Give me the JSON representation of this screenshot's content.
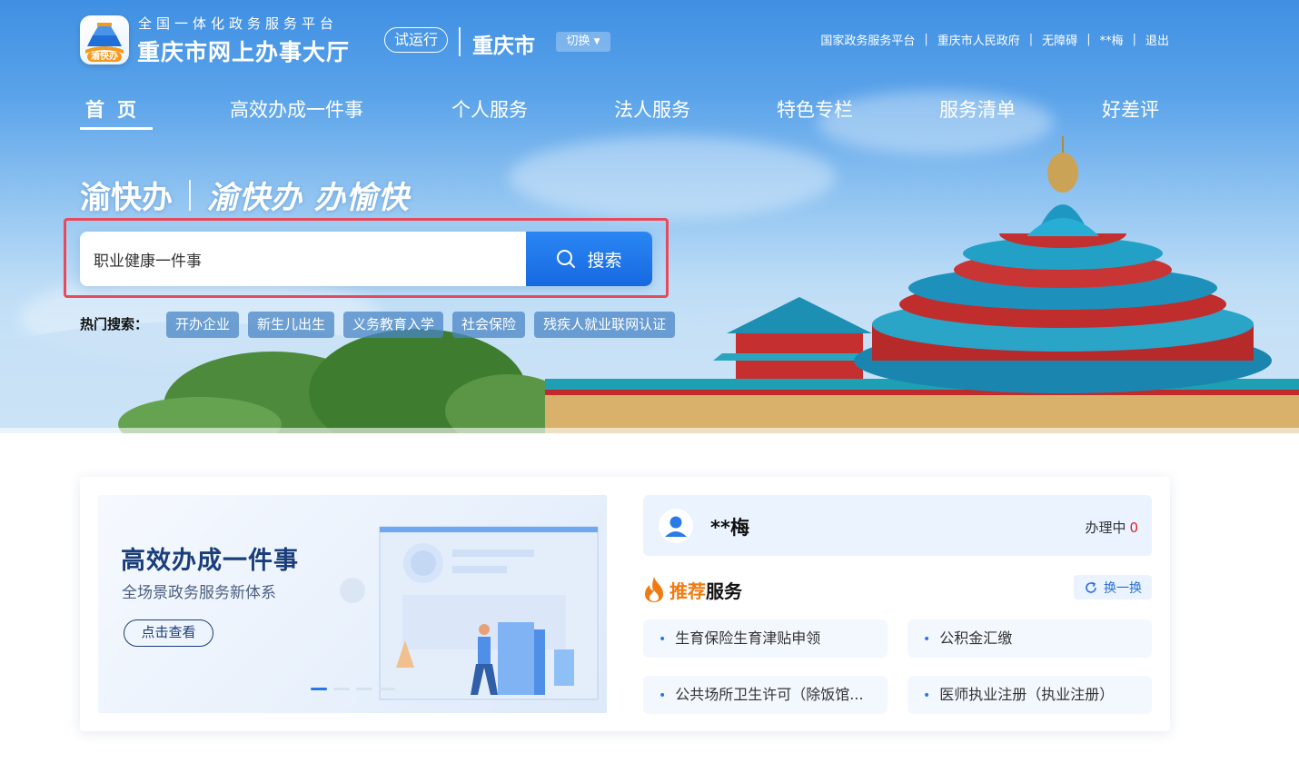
{
  "header": {
    "platform_subtitle": "全国一体化政务服务平台",
    "site_title": "重庆市网上办事大厅",
    "logo_text": "渝快办",
    "trial_badge": "试运行",
    "city": "重庆市",
    "switch_label": "切换",
    "top_links": [
      "国家政务服务平台",
      "重庆市人民政府",
      "无障碍",
      "**梅",
      "退出"
    ]
  },
  "nav": {
    "items": [
      "首页",
      "高效办成一件事",
      "个人服务",
      "法人服务",
      "特色专栏",
      "服务清单",
      "好差评"
    ]
  },
  "slogan": {
    "brand": "渝快办",
    "tagline": "渝快办 办愉快"
  },
  "search": {
    "value": "职业健康一件事",
    "button_label": "搜索",
    "hot_label": "热门搜索：",
    "hot_tags": [
      "开办企业",
      "新生儿出生",
      "义务教育入学",
      "社会保险",
      "残疾人就业联网认证"
    ]
  },
  "banner": {
    "title": "高效办成一件事",
    "subtitle": "全场景政务服务新体系",
    "button_label": "点击查看",
    "slide_count": 4,
    "active_slide": 1
  },
  "user": {
    "name": "**梅",
    "in_progress_label": "办理中",
    "in_progress_count": "0"
  },
  "recommend": {
    "title_highlight": "推荐",
    "title_rest": "服务",
    "refresh_label": "换一换",
    "services": [
      "生育保险生育津贴申领",
      "公积金汇缴",
      "公共场所卫生许可（除饭馆...",
      "医师执业注册（执业注册）"
    ]
  },
  "colors": {
    "primary": "#1769e0",
    "accent_orange": "#f07a12",
    "highlight_frame": "#e94a5a",
    "nav_text": "#ffffff"
  },
  "icons": [
    "logo-icon",
    "search-icon",
    "caret-down-icon",
    "user-avatar-icon",
    "flame-icon",
    "refresh-icon"
  ]
}
